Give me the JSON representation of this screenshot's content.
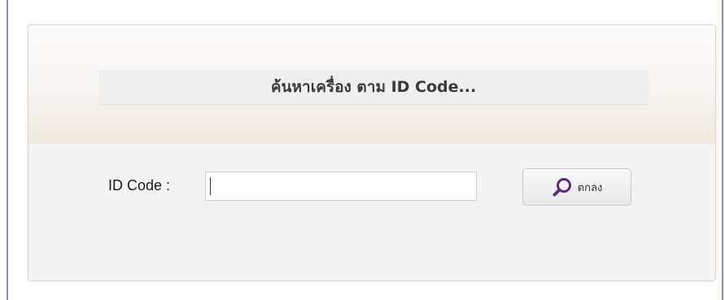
{
  "search_form": {
    "title": "ค้นหาเครื่อง ตาม ID Code...",
    "id_label": "ID Code :",
    "id_value": "",
    "submit_label": "ตกลง",
    "submit_icon": "search-icon",
    "accent_color": "#5b2c83"
  }
}
